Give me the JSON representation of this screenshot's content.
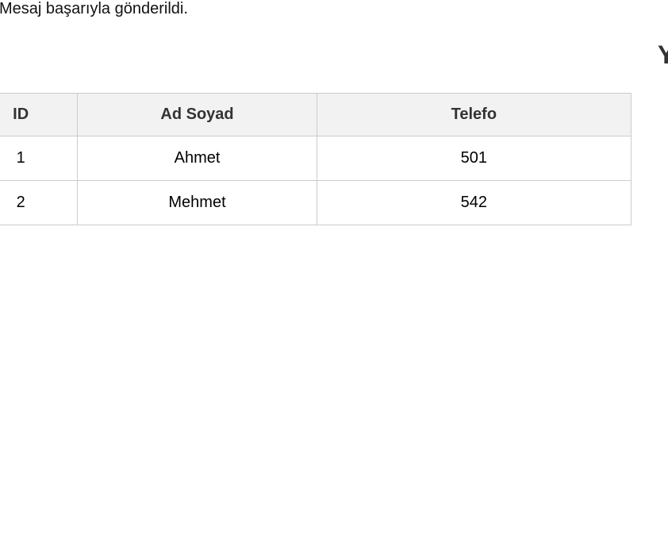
{
  "flash": {
    "message": "Mesaj başarıyla gönderildi."
  },
  "page": {
    "title": "Y"
  },
  "table": {
    "headers": {
      "id": "ID",
      "name": "Ad Soyad",
      "phone": "Telefo"
    },
    "rows": [
      {
        "id": "1",
        "name": "Ahmet",
        "phone": "501"
      },
      {
        "id": "2",
        "name": "Mehmet",
        "phone": "542"
      }
    ]
  },
  "colors": {
    "header_background": "#f2f2f2",
    "border": "#cccccc",
    "header_text": "#333333"
  }
}
